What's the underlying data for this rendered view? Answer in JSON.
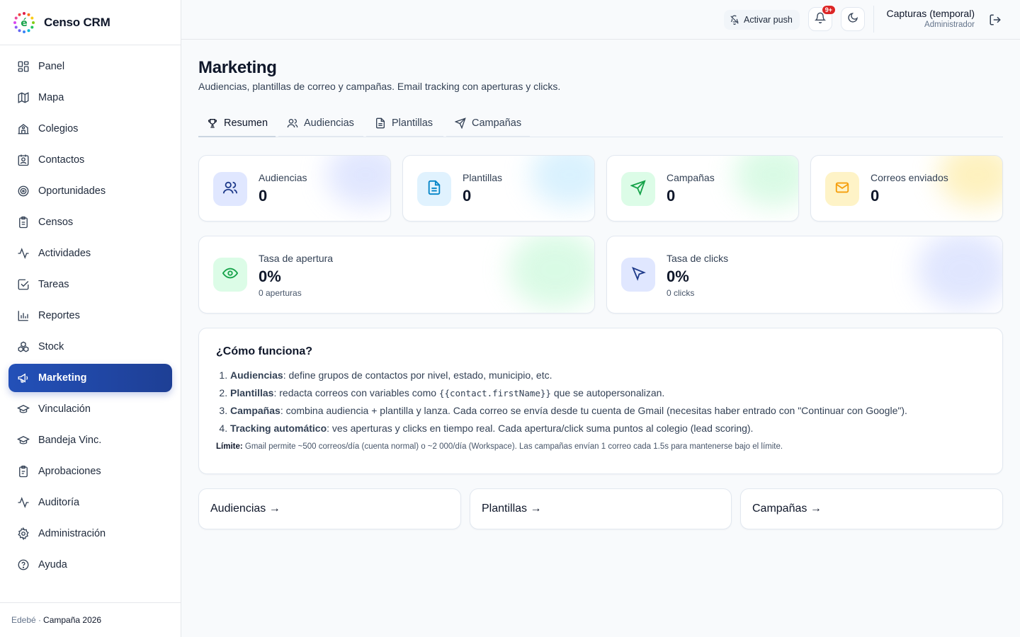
{
  "brand": {
    "name": "Censo CRM",
    "logo_letter": "é"
  },
  "sidebar": {
    "items": [
      {
        "label": "Panel",
        "icon": "layout-grid-icon",
        "active": false
      },
      {
        "label": "Mapa",
        "icon": "map-icon",
        "active": false
      },
      {
        "label": "Colegios",
        "icon": "school-icon",
        "active": false
      },
      {
        "label": "Contactos",
        "icon": "contact-icon",
        "active": false
      },
      {
        "label": "Oportunidades",
        "icon": "target-icon",
        "active": false
      },
      {
        "label": "Censos",
        "icon": "clipboard-icon",
        "active": false
      },
      {
        "label": "Actividades",
        "icon": "activity-icon",
        "active": false
      },
      {
        "label": "Tareas",
        "icon": "check-square-icon",
        "active": false
      },
      {
        "label": "Reportes",
        "icon": "bar-chart-icon",
        "active": false
      },
      {
        "label": "Stock",
        "icon": "boxes-icon",
        "active": false
      },
      {
        "label": "Marketing",
        "icon": "megaphone-icon",
        "active": true
      },
      {
        "label": "Vinculación",
        "icon": "graduation-cap-icon",
        "active": false
      },
      {
        "label": "Bandeja Vinc.",
        "icon": "graduation-cap-icon",
        "active": false
      },
      {
        "label": "Aprobaciones",
        "icon": "clipboard-check-icon",
        "active": false
      },
      {
        "label": "Auditoría",
        "icon": "activity-icon",
        "active": false
      },
      {
        "label": "Administración",
        "icon": "gear-icon",
        "active": false
      },
      {
        "label": "Ayuda",
        "icon": "help-circle-icon",
        "active": false
      }
    ],
    "footer_org": "Edebé ·",
    "footer_campaign": "Campaña 2026"
  },
  "topbar": {
    "push_label": "Activar push",
    "notif_badge": "9+",
    "user_name": "Capturas (temporal)",
    "user_role": "Administrador"
  },
  "page": {
    "title": "Marketing",
    "subtitle": "Audiencias, plantillas de correo y campañas. Email tracking con aperturas y clicks."
  },
  "tabs": [
    {
      "label": "Resumen",
      "icon": "trophy-icon",
      "active": true
    },
    {
      "label": "Audiencias",
      "icon": "users-icon",
      "active": false
    },
    {
      "label": "Plantillas",
      "icon": "file-text-icon",
      "active": false
    },
    {
      "label": "Campañas",
      "icon": "send-icon",
      "active": false
    }
  ],
  "stats": {
    "audiencias": {
      "label": "Audiencias",
      "value": "0",
      "color": "#1e3a8a"
    },
    "plantillas": {
      "label": "Plantillas",
      "value": "0",
      "color": "#0284c7"
    },
    "campanas": {
      "label": "Campañas",
      "value": "0",
      "color": "#16a34a"
    },
    "correos": {
      "label": "Correos enviados",
      "value": "0",
      "color": "#f59e0b"
    },
    "apertura": {
      "label": "Tasa de apertura",
      "value": "0%",
      "sub": "0 aperturas",
      "color": "#16a34a"
    },
    "clicks": {
      "label": "Tasa de clicks",
      "value": "0%",
      "sub": "0 clicks",
      "color": "#1e3a8a"
    }
  },
  "howto": {
    "title": "¿Cómo funciona?",
    "steps": [
      {
        "term": "Audiencias",
        "text": ": define grupos de contactos por nivel, estado, municipio, etc."
      },
      {
        "term": "Plantillas",
        "text_before": ": redacta correos con variables como ",
        "code": "{{contact.firstName}}",
        "text_after": " que se autopersonalizan."
      },
      {
        "term": "Campañas",
        "text": ": combina audiencia + plantilla y lanza. Cada correo se envía desde tu cuenta de Gmail (necesitas haber entrado con \"Continuar con Google\")."
      },
      {
        "term": "Tracking automático",
        "text": ": ves aperturas y clicks en tiempo real. Cada apertura/click suma puntos al colegio (lead scoring)."
      }
    ],
    "limit_label": "Límite:",
    "limit_text": " Gmail permite ~500 correos/día (cuenta normal) o ~2 000/día (Workspace). Las campañas envían 1 correo cada 1.5s para mantenerse bajo el límite."
  },
  "links": [
    {
      "label": "Audiencias →"
    },
    {
      "label": "Plantillas →"
    },
    {
      "label": "Campañas →"
    }
  ]
}
